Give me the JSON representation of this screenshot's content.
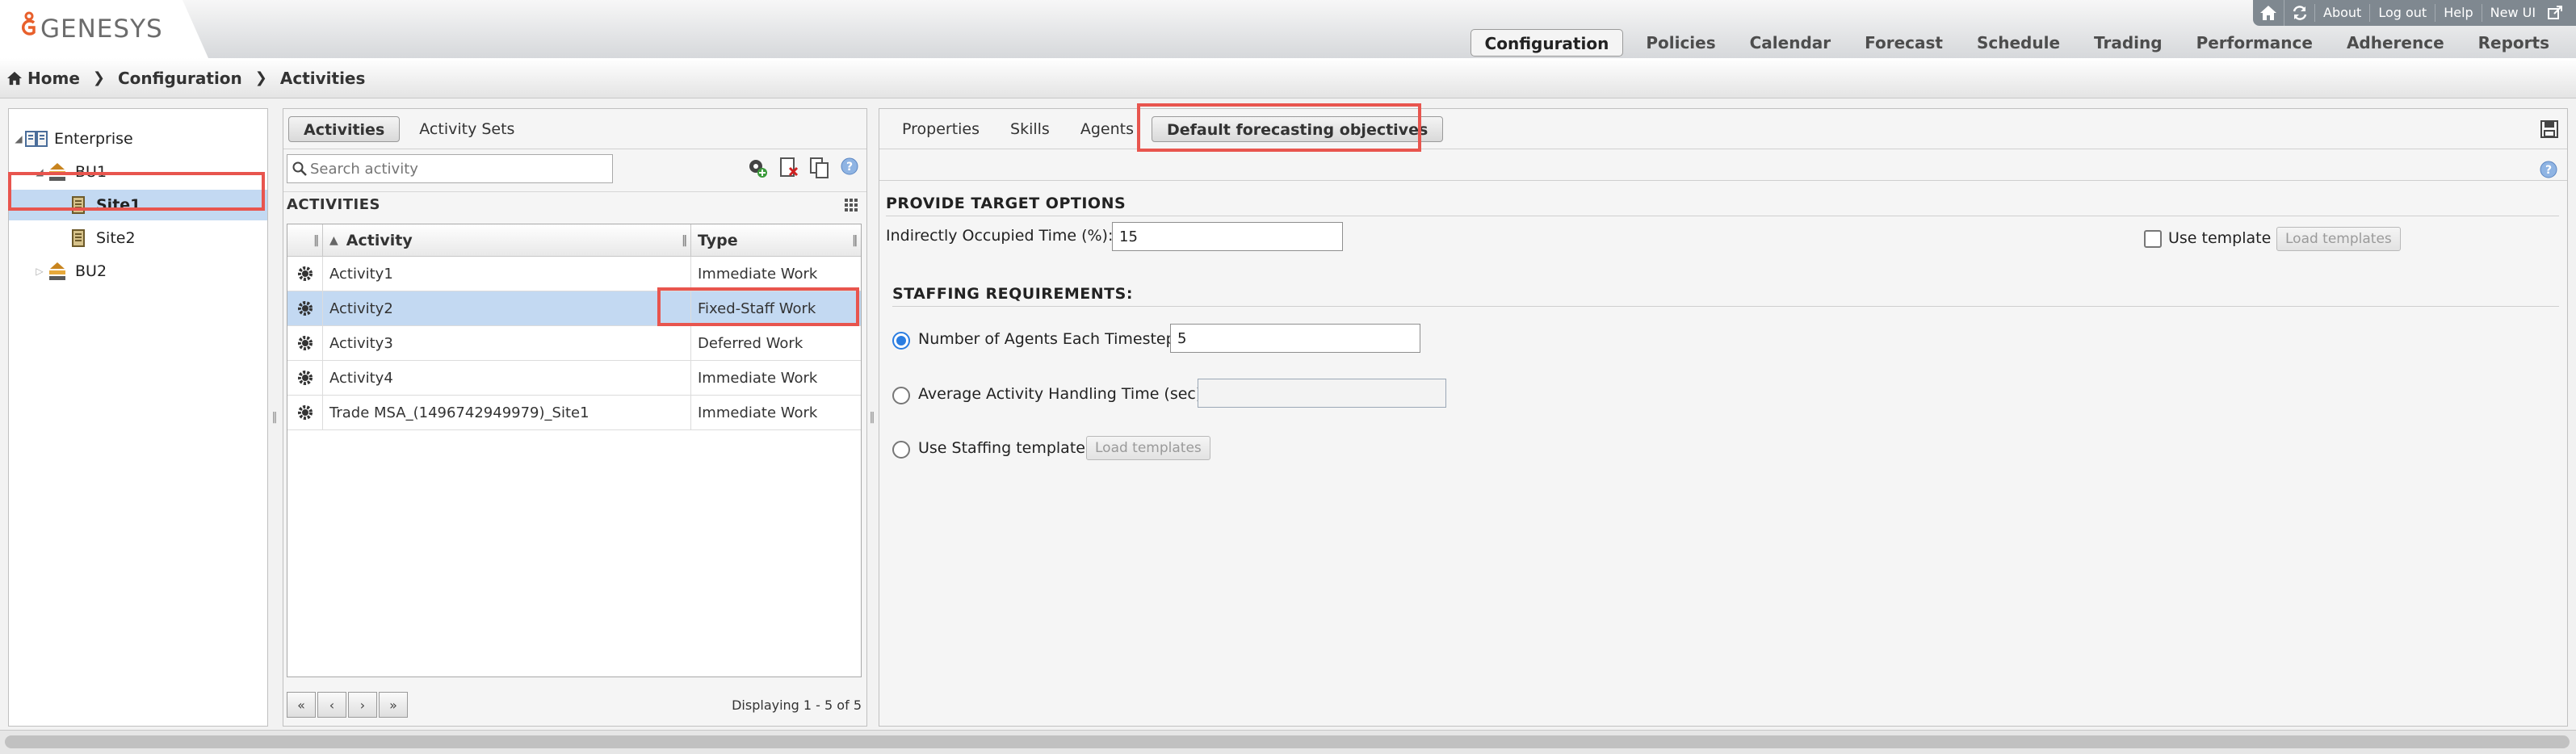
{
  "app": {
    "brand": "GENESYS"
  },
  "utility_links": [
    "About",
    "Log out",
    "Help",
    "New UI"
  ],
  "nav": {
    "items": [
      "Configuration",
      "Policies",
      "Calendar",
      "Forecast",
      "Schedule",
      "Trading",
      "Performance",
      "Adherence",
      "Reports"
    ],
    "active": "Configuration"
  },
  "breadcrumb": [
    "Home",
    "Configuration",
    "Activities"
  ],
  "tree": [
    {
      "label": "Enterprise",
      "icon": "enterprise-icon",
      "level": 0,
      "expanded": true
    },
    {
      "label": "BU1",
      "icon": "business-unit-icon",
      "level": 1,
      "expanded": true
    },
    {
      "label": "Site1",
      "icon": "site-icon",
      "level": 2,
      "selected": true
    },
    {
      "label": "Site2",
      "icon": "site-icon",
      "level": 2
    },
    {
      "label": "BU2",
      "icon": "business-unit-icon",
      "level": 1,
      "expanded": false
    }
  ],
  "activities_panel": {
    "tabs": [
      "Activities",
      "Activity Sets"
    ],
    "active_tab": "Activities",
    "search_placeholder": "Search activity",
    "section_title": "ACTIVITIES",
    "columns": [
      "Activity",
      "Type"
    ],
    "rows": [
      {
        "activity": "Activity1",
        "type": "Immediate Work"
      },
      {
        "activity": "Activity2",
        "type": "Fixed-Staff Work",
        "selected": true
      },
      {
        "activity": "Activity3",
        "type": "Deferred Work"
      },
      {
        "activity": "Activity4",
        "type": "Immediate Work"
      },
      {
        "activity": "Trade MSA_(1496742949979)_Site1",
        "type": "Immediate Work"
      }
    ],
    "pager": {
      "first": "«",
      "prev": "‹",
      "next": "›",
      "last": "»",
      "info": "Displaying 1 - 5 of 5"
    }
  },
  "detail_panel": {
    "tabs": [
      "Properties",
      "Skills",
      "Agents",
      "Default forecasting objectives"
    ],
    "active_tab": "Default forecasting objectives",
    "target_options": {
      "title": "PROVIDE TARGET OPTIONS",
      "ioc_label": "Indirectly Occupied Time (%):",
      "ioc_value": "15",
      "use_template_label": "Use template",
      "use_template_checked": false,
      "load_templates_label": "Load templates"
    },
    "staffing": {
      "title": "STAFFING REQUIREMENTS:",
      "options": [
        {
          "label": "Number of Agents Each Timestep",
          "value": "5",
          "selected": true
        },
        {
          "label": "Average Activity Handling Time (sec)",
          "value": "",
          "selected": false
        },
        {
          "label": "Use Staffing template",
          "selected": false
        }
      ],
      "load_templates_label": "Load templates"
    }
  },
  "colors": {
    "selection": "#c3d9f2",
    "highlight": "#e8554e",
    "radio_accent": "#2a7de1",
    "brand_orange": "#e8602c"
  }
}
